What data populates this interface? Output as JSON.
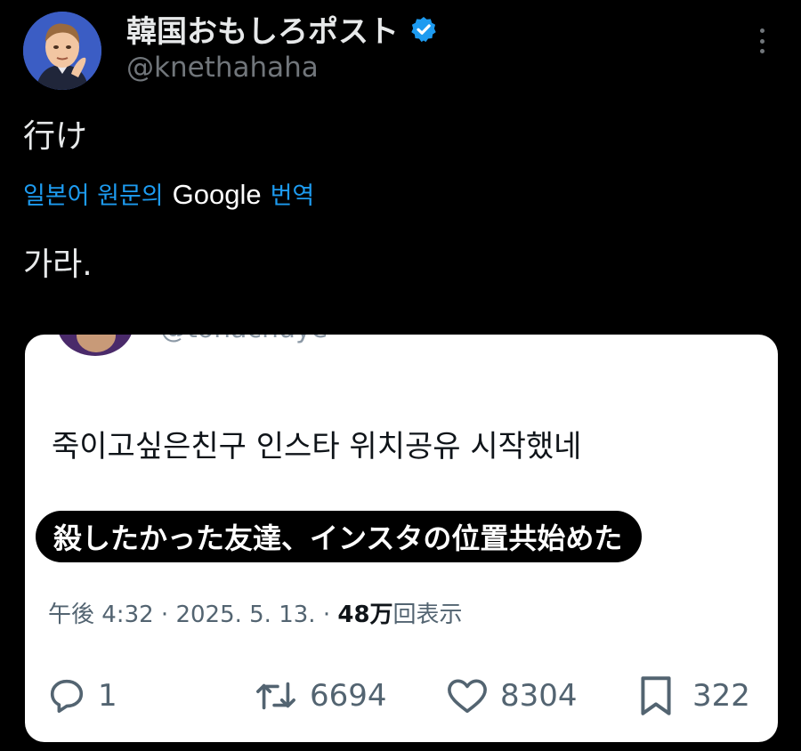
{
  "header": {
    "display_name": "韓国おもしろポスト",
    "handle": "@knethahaha",
    "verified_color": "#1d9bf0",
    "more_icon": "more-vertical-icon"
  },
  "tweet": {
    "text": "行け",
    "translate_prefix": "일본어 원문의",
    "translate_google": "Google",
    "translate_suffix": "번역",
    "translated_text": "가라."
  },
  "embedded": {
    "handle_partial": "@tonachuye",
    "text": "죽이고싶은친구 인스타 위치공유 시작했네",
    "subtitle": "殺したかった友達、インスタの位置共始めた",
    "meta_time": "午後 4:32 · 2025. 5. 13. · ",
    "meta_views": "48万",
    "meta_views_suffix": "回表示",
    "actions": {
      "reply_count": "1",
      "retweet_count": "6694",
      "like_count": "8304",
      "bookmark_count": "322"
    }
  },
  "colors": {
    "background": "#000000",
    "link": "#1d9bf0",
    "muted": "#71767b",
    "card": "#ffffff"
  }
}
